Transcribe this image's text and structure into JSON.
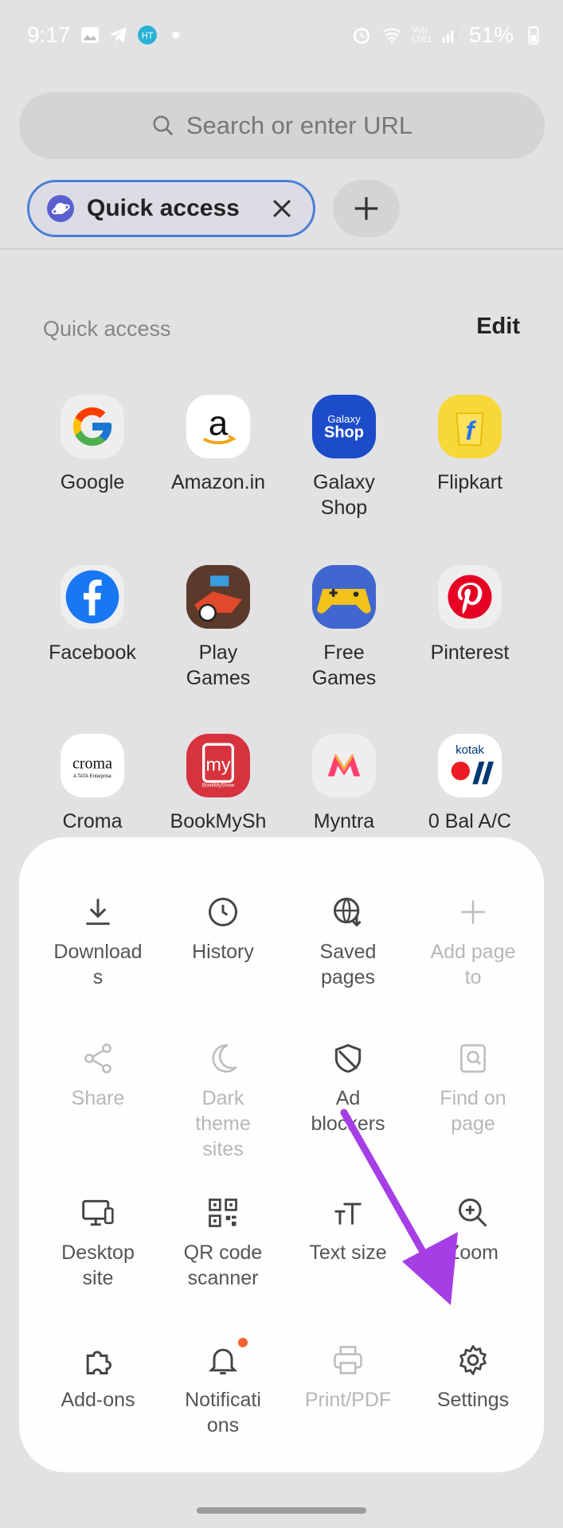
{
  "status_bar": {
    "time": "9:17",
    "network": "Vo)) LTE1",
    "battery": "51%"
  },
  "url_bar": {
    "placeholder": "Search or enter URL"
  },
  "tab": {
    "title": "Quick access"
  },
  "quick_access": {
    "title": "Quick access",
    "edit_label": "Edit",
    "tiles": [
      {
        "label": "Google",
        "icon": "google-icon"
      },
      {
        "label": "Amazon.in",
        "icon": "amazon-icon"
      },
      {
        "label": "Galaxy\nShop",
        "icon": "galaxy-shop-icon",
        "icon_text": "Galaxy Shop"
      },
      {
        "label": "Flipkart",
        "icon": "flipkart-icon"
      },
      {
        "label": "Facebook",
        "icon": "facebook-icon"
      },
      {
        "label": "Play\nGames",
        "icon": "play-games-icon"
      },
      {
        "label": "Free\nGames",
        "icon": "free-games-icon"
      },
      {
        "label": "Pinterest",
        "icon": "pinterest-icon"
      },
      {
        "label": "Croma",
        "icon": "croma-icon",
        "icon_text": "croma",
        "icon_subtext": "A TATA Enterprise"
      },
      {
        "label": "BookMySh",
        "icon": "bookmyshow-icon",
        "icon_text": "my",
        "icon_subtext": "BookMyShow"
      },
      {
        "label": "Myntra",
        "icon": "myntra-icon"
      },
      {
        "label": "0 Bal A/C",
        "icon": "kotak-icon",
        "icon_text": "kotak"
      }
    ]
  },
  "menu": {
    "items": [
      {
        "label": "Download\ns",
        "icon": "download-icon",
        "enabled": true
      },
      {
        "label": "History",
        "icon": "clock-icon",
        "enabled": true
      },
      {
        "label": "Saved\npages",
        "icon": "globe-download-icon",
        "enabled": true
      },
      {
        "label": "Add page\nto",
        "icon": "plus-icon",
        "enabled": false
      },
      {
        "label": "Share",
        "icon": "share-icon",
        "enabled": false
      },
      {
        "label": "Dark\ntheme\nsites",
        "icon": "moon-icon",
        "enabled": false
      },
      {
        "label": "Ad\nblockers",
        "icon": "shield-icon",
        "enabled": true
      },
      {
        "label": "Find on\npage",
        "icon": "find-on-page-icon",
        "enabled": false
      },
      {
        "label": "Desktop\nsite",
        "icon": "desktop-icon",
        "enabled": true
      },
      {
        "label": "QR code\nscanner",
        "icon": "qr-code-icon",
        "enabled": true
      },
      {
        "label": "Text size",
        "icon": "text-size-icon",
        "enabled": true
      },
      {
        "label": "Zoom",
        "icon": "zoom-icon",
        "enabled": true
      },
      {
        "label": "Add-ons",
        "icon": "puzzle-icon",
        "enabled": true
      },
      {
        "label": "Notificati\nons",
        "icon": "bell-icon",
        "enabled": true,
        "badge": true
      },
      {
        "label": "Print/PDF",
        "icon": "printer-icon",
        "enabled": false
      },
      {
        "label": "Settings",
        "icon": "gear-icon",
        "enabled": true
      }
    ]
  },
  "colors": {
    "accent": "#4a7fd8",
    "annotation_arrow": "#a63ee6",
    "notification_dot": "#f2642f",
    "menu_text": "#555555",
    "menu_disabled": "#b7b7b7"
  }
}
